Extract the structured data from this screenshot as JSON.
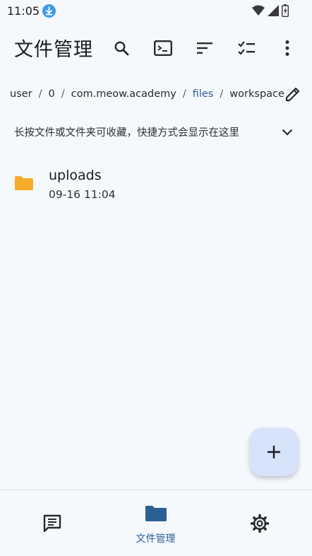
{
  "status_bar": {
    "time": "11:05",
    "download_icon": "download-icon",
    "right_icons": [
      "wifi-icon",
      "cellular-signal-icon",
      "battery-icon"
    ]
  },
  "app_bar": {
    "title": "文件管理",
    "actions": [
      "search-icon",
      "terminal-icon",
      "sort-icon",
      "checklist-icon",
      "more-vert-icon"
    ]
  },
  "breadcrumb": {
    "segments": [
      "user",
      "0",
      "com.meow.academy",
      "files",
      "workspace"
    ],
    "separator": "/",
    "edit_icon": "pencil-icon"
  },
  "hint": {
    "text": "长按文件或文件夹可收藏，快捷方式会显示在这里",
    "toggle_icon": "chevron-down-icon"
  },
  "files": [
    {
      "name": "uploads",
      "date": "09-16 11:04",
      "icon": "folder-icon"
    }
  ],
  "fab": {
    "icon": "plus-icon"
  },
  "bottom_nav": {
    "items": [
      {
        "icon": "chat-icon",
        "label": ""
      },
      {
        "icon": "folder-icon",
        "label": "文件管理"
      },
      {
        "icon": "gear-icon",
        "label": ""
      }
    ]
  },
  "colors": {
    "background": "#f5f8fd",
    "accent": "#2c5f93",
    "folder": "#f6ad2b",
    "fab": "#d6e3fa",
    "download_badge": "#3d9be9"
  }
}
